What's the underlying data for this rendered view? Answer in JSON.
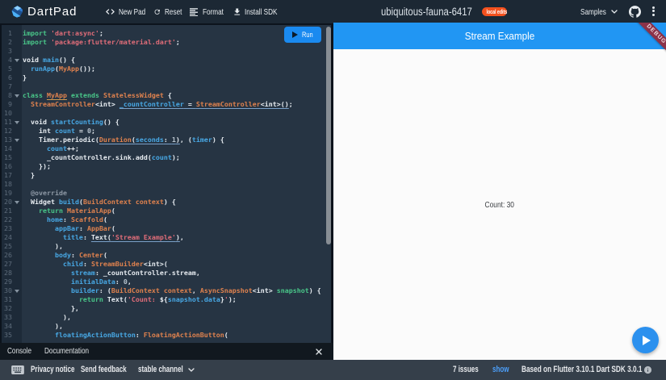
{
  "topnav": {
    "brand": "DartPad",
    "items": [
      {
        "icon": "code-icon",
        "label": "New Pad"
      },
      {
        "icon": "refresh-icon",
        "label": "Reset"
      },
      {
        "icon": "format-icon",
        "label": "Format"
      },
      {
        "icon": "download-icon",
        "label": "Install SDK"
      }
    ],
    "pad_name": "ubiquitous-fauna-6417",
    "badge": "local edits",
    "samples_label": "Samples"
  },
  "editor": {
    "run_label": "Run",
    "fold_lines": [
      4,
      8,
      11,
      13,
      20,
      30
    ],
    "lines": [
      [
        [
          "k",
          "import"
        ],
        [
          "p",
          " "
        ],
        [
          "s",
          "'dart:async'"
        ],
        [
          "p",
          ";"
        ]
      ],
      [
        [
          "k",
          "import"
        ],
        [
          "p",
          " "
        ],
        [
          "s",
          "'package:flutter/material.dart'"
        ],
        [
          "p",
          ";"
        ]
      ],
      [],
      [
        [
          "p",
          "void "
        ],
        [
          "f",
          "main"
        ],
        [
          "p",
          "() {"
        ]
      ],
      [
        [
          "p",
          "  "
        ],
        [
          "f",
          "runApp"
        ],
        [
          "p",
          "("
        ],
        [
          "t",
          "MyApp"
        ],
        [
          "p",
          "());"
        ]
      ],
      [
        [
          "p",
          "}"
        ]
      ],
      [],
      [
        [
          "k",
          "class"
        ],
        [
          "p",
          " "
        ],
        [
          "t uo",
          "MyApp"
        ],
        [
          "p",
          " "
        ],
        [
          "k",
          "extends"
        ],
        [
          "p",
          " "
        ],
        [
          "t",
          "StatelessWidget"
        ],
        [
          "p",
          " {"
        ]
      ],
      [
        [
          "p",
          "  "
        ],
        [
          "t",
          "StreamController"
        ],
        [
          "p",
          "<int> "
        ],
        [
          "f u",
          "_countController"
        ],
        [
          "p u",
          " = "
        ],
        [
          "t u",
          "StreamController"
        ],
        [
          "p u",
          "<int>()"
        ],
        [
          "p",
          ";"
        ]
      ],
      [],
      [
        [
          "p",
          "  void "
        ],
        [
          "f",
          "startCounting"
        ],
        [
          "p",
          "() {"
        ]
      ],
      [
        [
          "p",
          "    int "
        ],
        [
          "f",
          "count"
        ],
        [
          "p",
          " = "
        ],
        [
          "n",
          "0"
        ],
        [
          "p",
          ";"
        ]
      ],
      [
        [
          "p",
          "    Timer.periodic("
        ],
        [
          "t u",
          "Duration"
        ],
        [
          "p u",
          "("
        ],
        [
          "f u",
          "seconds"
        ],
        [
          "p u",
          ": "
        ],
        [
          "n u",
          "1"
        ],
        [
          "p u",
          ")"
        ],
        [
          "p",
          ", ("
        ],
        [
          "f",
          "timer"
        ],
        [
          "p",
          ") {"
        ]
      ],
      [
        [
          "p",
          "      "
        ],
        [
          "f",
          "count"
        ],
        [
          "p",
          "++;"
        ]
      ],
      [
        [
          "p",
          "      _countController.sink.add("
        ],
        [
          "f",
          "count"
        ],
        [
          "p",
          ");"
        ]
      ],
      [
        [
          "p",
          "    });"
        ]
      ],
      [
        [
          "p",
          "  }"
        ]
      ],
      [],
      [
        [
          "p",
          "  "
        ],
        [
          "c",
          "@override"
        ]
      ],
      [
        [
          "p",
          "  Widget "
        ],
        [
          "f",
          "build"
        ],
        [
          "p",
          "("
        ],
        [
          "t",
          "BuildContext context"
        ],
        [
          "p",
          ") {"
        ]
      ],
      [
        [
          "p",
          "    "
        ],
        [
          "k",
          "return"
        ],
        [
          "p",
          " "
        ],
        [
          "t",
          "MaterialApp"
        ],
        [
          "p",
          "("
        ]
      ],
      [
        [
          "p",
          "      "
        ],
        [
          "f",
          "home"
        ],
        [
          "p",
          ": "
        ],
        [
          "t",
          "Scaffold"
        ],
        [
          "p",
          "("
        ]
      ],
      [
        [
          "p",
          "        "
        ],
        [
          "f",
          "appBar"
        ],
        [
          "p",
          ": "
        ],
        [
          "t",
          "AppBar"
        ],
        [
          "p",
          "("
        ]
      ],
      [
        [
          "p",
          "          "
        ],
        [
          "f",
          "title"
        ],
        [
          "p",
          ": "
        ],
        [
          "p u",
          "Text("
        ],
        [
          "s u",
          "'Stream Example'"
        ],
        [
          "p u",
          ")"
        ],
        [
          "p",
          ","
        ]
      ],
      [
        [
          "p",
          "        ),"
        ]
      ],
      [
        [
          "p",
          "        "
        ],
        [
          "f",
          "body"
        ],
        [
          "p",
          ": "
        ],
        [
          "t",
          "Center"
        ],
        [
          "p",
          "("
        ]
      ],
      [
        [
          "p",
          "          "
        ],
        [
          "f",
          "child"
        ],
        [
          "p",
          ": "
        ],
        [
          "t",
          "StreamBuilder"
        ],
        [
          "p",
          "<int>("
        ]
      ],
      [
        [
          "p",
          "            "
        ],
        [
          "f",
          "stream"
        ],
        [
          "p",
          ": _countController.stream,"
        ]
      ],
      [
        [
          "p",
          "            "
        ],
        [
          "f",
          "initialData"
        ],
        [
          "p",
          ": "
        ],
        [
          "n",
          "0"
        ],
        [
          "p",
          ","
        ]
      ],
      [
        [
          "p",
          "            "
        ],
        [
          "f",
          "builder"
        ],
        [
          "p",
          ": ("
        ],
        [
          "t",
          "BuildContext context"
        ],
        [
          "p",
          ", "
        ],
        [
          "t",
          "AsyncSnapshot"
        ],
        [
          "p",
          "<int> "
        ],
        [
          "k",
          "snapshot"
        ],
        [
          "p",
          ") {"
        ]
      ],
      [
        [
          "p",
          "              "
        ],
        [
          "k",
          "return"
        ],
        [
          "p",
          " Text("
        ],
        [
          "s",
          "'Count: "
        ],
        [
          "p",
          "${"
        ],
        [
          "f",
          "snapshot.data"
        ],
        [
          "p",
          "}"
        ],
        [
          "s",
          "'"
        ],
        [
          "p",
          ");"
        ]
      ],
      [
        [
          "p",
          "            },"
        ]
      ],
      [
        [
          "p",
          "          ),"
        ]
      ],
      [
        [
          "p",
          "        ),"
        ]
      ],
      [
        [
          "p",
          "        "
        ],
        [
          "f",
          "floatingActionButton"
        ],
        [
          "p",
          ": "
        ],
        [
          "t",
          "FloatingActionButton"
        ],
        [
          "p",
          "("
        ]
      ]
    ]
  },
  "preview": {
    "appbar_title": "Stream Example",
    "debug_banner": "DEBUG",
    "count_text": "Count: 30"
  },
  "console_bar": {
    "tabs": [
      "Console",
      "Documentation"
    ],
    "close": "×"
  },
  "footer": {
    "privacy": "Privacy notice",
    "feedback": "Send feedback",
    "channel": "stable channel",
    "issues": "7 issues",
    "show": "show",
    "version": "Based on Flutter 3.10.1 Dart SDK 3.0.1"
  }
}
